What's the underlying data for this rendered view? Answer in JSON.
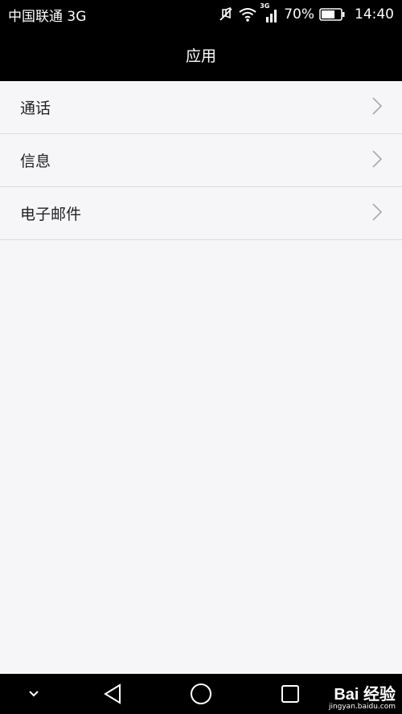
{
  "status_bar": {
    "carrier": "中国联通 3G",
    "network_label": "3G",
    "battery_percent": "70%",
    "time": "14:40",
    "battery_level": 0.7
  },
  "header": {
    "title": "应用"
  },
  "list": {
    "items": [
      {
        "label": "通话"
      },
      {
        "label": "信息"
      },
      {
        "label": "电子邮件"
      }
    ]
  },
  "nav_bar": {
    "icons": [
      "chevron-down-icon",
      "back-icon",
      "home-icon",
      "recents-icon"
    ]
  },
  "watermark": {
    "brand": "Bai 经验",
    "url": "jingyan.baidu.com"
  }
}
